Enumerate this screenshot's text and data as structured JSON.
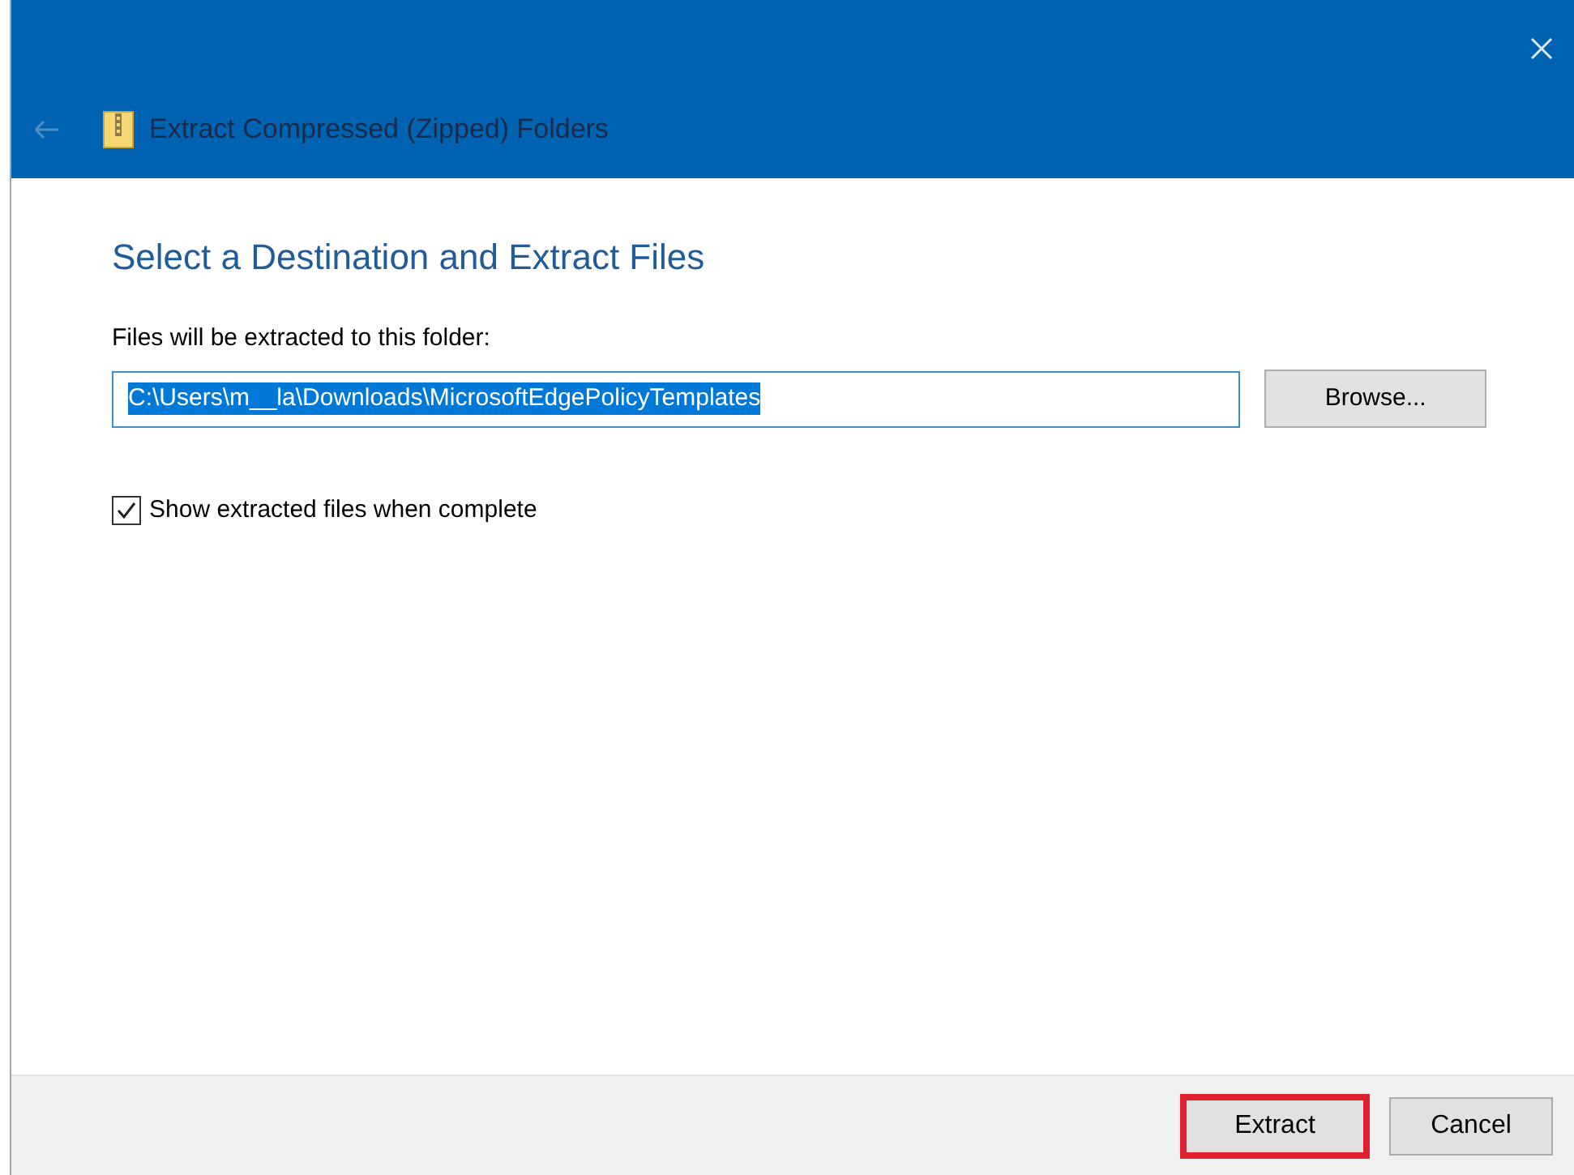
{
  "window": {
    "title": "Extract Compressed (Zipped) Folders",
    "back_disabled": true
  },
  "heading": "Select a Destination and Extract Files",
  "destination": {
    "label": "Files will be extracted to this folder:",
    "value": "C:\\Users\\m__la\\Downloads\\MicrosoftEdgePolicyTemplates",
    "selected": true
  },
  "browse_button": {
    "label": "Browse..."
  },
  "show_files": {
    "label": "Show extracted files when complete",
    "checked": true
  },
  "buttons": [
    {
      "label": "Extract",
      "highlighted": true
    },
    {
      "label": "Cancel",
      "highlighted": false
    }
  ]
}
